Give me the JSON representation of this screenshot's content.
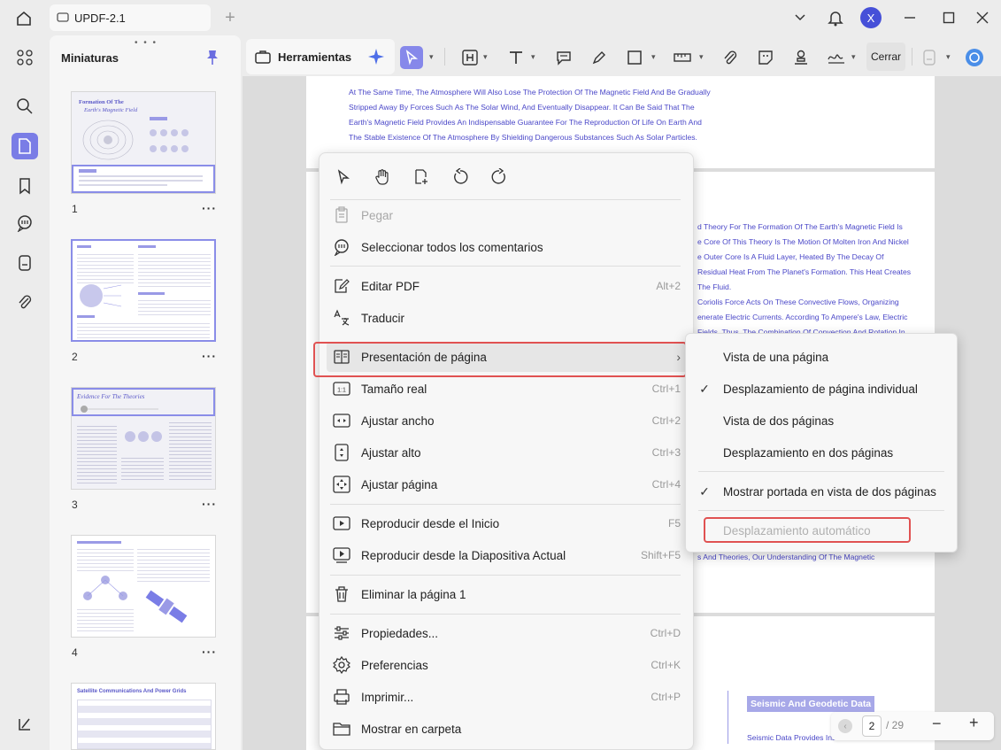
{
  "titlebar": {
    "tab_title": "UPDF-2.1",
    "avatar_letter": "X"
  },
  "thumbnails": {
    "title": "Miniaturas",
    "pages": [
      {
        "number": "1",
        "title_line1": "Formation Of The",
        "title_line2": "Earth's Magnetic Field"
      },
      {
        "number": "2"
      },
      {
        "number": "3",
        "title": "Evidence For The Theories"
      },
      {
        "number": "4"
      },
      {
        "number": "",
        "title": "Satellite Communications And Power Grids"
      }
    ]
  },
  "toolbar": {
    "tools_label": "Herramientas",
    "close_label": "Cerrar"
  },
  "document": {
    "lines_top": [
      "At The Same Time, The Atmosphere Will Also Lose The Protection Of The Magnetic Field And Be Gradually",
      "Stripped Away By Forces Such As The Solar Wind, And Eventually Disappear. It Can Be Said That The",
      "Earth's Magnetic Field Provides An Indispensable Guarantee For The Reproduction Of Life On Earth And",
      "The Stable Existence Of The Atmosphere By Shielding Dangerous Substances Such As Solar Particles."
    ],
    "lines_right": [
      "d Theory For The Formation Of The Earth's Magnetic Field Is",
      "e Core Of This Theory Is The Motion Of Molten Iron And Nickel",
      "e Outer Core Is A Fluid Layer, Heated By The Decay Of",
      "Residual Heat From The Planet's Formation. This Heat Creates",
      "The Fluid.",
      "Coriolis Force Acts On These Convective Flows, Organizing",
      "enerate Electric Currents. According To Ampere's Law, Electric",
      "Fields. Thus, The Combination Of Convection And Rotation In"
    ],
    "line_bottom": "s And Theories, Our Understanding Of The Magnetic",
    "seismic_title": "Seismic And Geodetic Data",
    "seismic_sub": "Seismic Data Provides Insi"
  },
  "pagenav": {
    "current": "2",
    "total": "/ 29"
  },
  "context_menu": {
    "items": [
      {
        "label": "Pegar",
        "shortcut": "",
        "disabled": true
      },
      {
        "label": "Seleccionar todos los comentarios",
        "shortcut": ""
      },
      {
        "label": "Editar PDF",
        "shortcut": "Alt+2"
      },
      {
        "label": "Traducir",
        "shortcut": ""
      },
      {
        "label": "Presentación de página",
        "shortcut": ""
      },
      {
        "label": "Tamaño real",
        "shortcut": "Ctrl+1"
      },
      {
        "label": "Ajustar ancho",
        "shortcut": "Ctrl+2"
      },
      {
        "label": "Ajustar alto",
        "shortcut": "Ctrl+3"
      },
      {
        "label": "Ajustar página",
        "shortcut": "Ctrl+4"
      },
      {
        "label": "Reproducir desde el Inicio",
        "shortcut": "F5"
      },
      {
        "label": "Reproducir desde la Diapositiva Actual",
        "shortcut": "Shift+F5"
      },
      {
        "label": "Eliminar la página 1",
        "shortcut": ""
      },
      {
        "label": "Propiedades...",
        "shortcut": "Ctrl+D"
      },
      {
        "label": "Preferencias",
        "shortcut": "Ctrl+K"
      },
      {
        "label": "Imprimir...",
        "shortcut": "Ctrl+P"
      },
      {
        "label": "Mostrar en carpeta",
        "shortcut": ""
      }
    ]
  },
  "submenu": {
    "items": [
      {
        "label": "Vista de una página",
        "checked": false
      },
      {
        "label": "Desplazamiento de página individual",
        "checked": true
      },
      {
        "label": "Vista de dos páginas",
        "checked": false
      },
      {
        "label": "Desplazamiento en dos páginas",
        "checked": false
      },
      {
        "label": "Mostrar portada en vista de dos páginas",
        "checked": true
      },
      {
        "label": "Desplazamiento automático",
        "checked": false,
        "disabled": true
      }
    ],
    "check_glyph": "✓"
  },
  "colors": {
    "accent": "#7a7de6",
    "highlight_red": "#e05252",
    "doc_text": "#4a47c8"
  }
}
